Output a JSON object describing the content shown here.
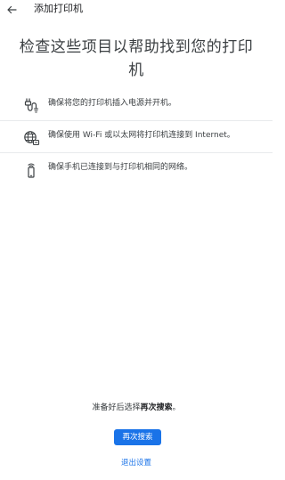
{
  "header": {
    "back_icon": "arrow-left-icon",
    "title": "添加打印机"
  },
  "headline": "检查这些项目以帮助找到您的打印机",
  "checklist": [
    {
      "icon": "power-plug-icon",
      "text": "确保将您的打印机插入电源并开机。"
    },
    {
      "icon": "globe-network-icon",
      "text": "确保使用 Wi-Fi 或以太网将打印机连接到 Internet。"
    },
    {
      "icon": "phone-wireless-icon",
      "text": "确保手机已连接到与打印机相同的网络。"
    }
  ],
  "footer": {
    "ready_prefix": "准备好后选择",
    "ready_emphasis": "再次搜索",
    "ready_suffix": "。",
    "search_again_label": "再次搜索",
    "exit_label": "退出设置"
  },
  "colors": {
    "accent": "#1a73e8",
    "text": "#3c4043",
    "divider": "#e8eaed"
  }
}
